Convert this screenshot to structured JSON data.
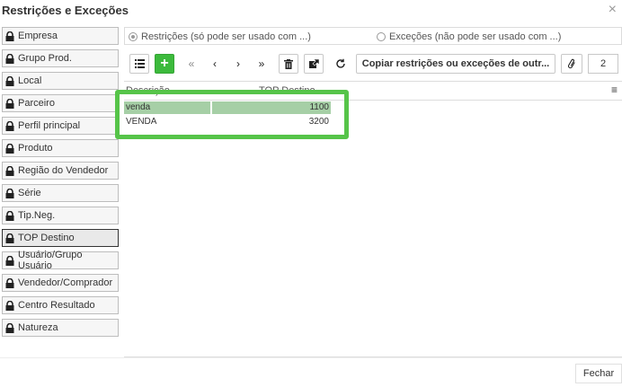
{
  "dialog": {
    "title": "Restrições e Exceções",
    "close_label": "×"
  },
  "sidebar": {
    "items": [
      {
        "label": "Empresa"
      },
      {
        "label": "Grupo Prod."
      },
      {
        "label": "Local"
      },
      {
        "label": "Parceiro"
      },
      {
        "label": "Perfil principal"
      },
      {
        "label": "Produto"
      },
      {
        "label": "Região do Vendedor"
      },
      {
        "label": "Série"
      },
      {
        "label": "Tip.Neg."
      },
      {
        "label": "TOP Destino",
        "active": true
      },
      {
        "label": "Usuário/Grupo Usuário"
      },
      {
        "label": "Vendedor/Comprador"
      },
      {
        "label": "Centro Resultado"
      },
      {
        "label": "Natureza"
      }
    ]
  },
  "mode": {
    "restrictions_label": "Restrições (só pode ser usado com ...)",
    "exceptions_label": "Exceções (não pode ser usado com ...)",
    "selected": "restrictions"
  },
  "toolbar": {
    "copy_label": "Copiar restrições ou exceções de outr...",
    "page_value": "2"
  },
  "grid": {
    "columns": [
      "Descrição",
      "TOP Destino"
    ],
    "rows": [
      {
        "descricao": "venda",
        "top": "1100",
        "selected": true
      },
      {
        "descricao": "VENDA",
        "top": "3200",
        "selected": false
      }
    ]
  },
  "footer": {
    "close_button": "Fechar"
  },
  "colors": {
    "highlight": "#56c449",
    "selected_row": "#a6cfa6",
    "add_button": "#3cba3c"
  }
}
